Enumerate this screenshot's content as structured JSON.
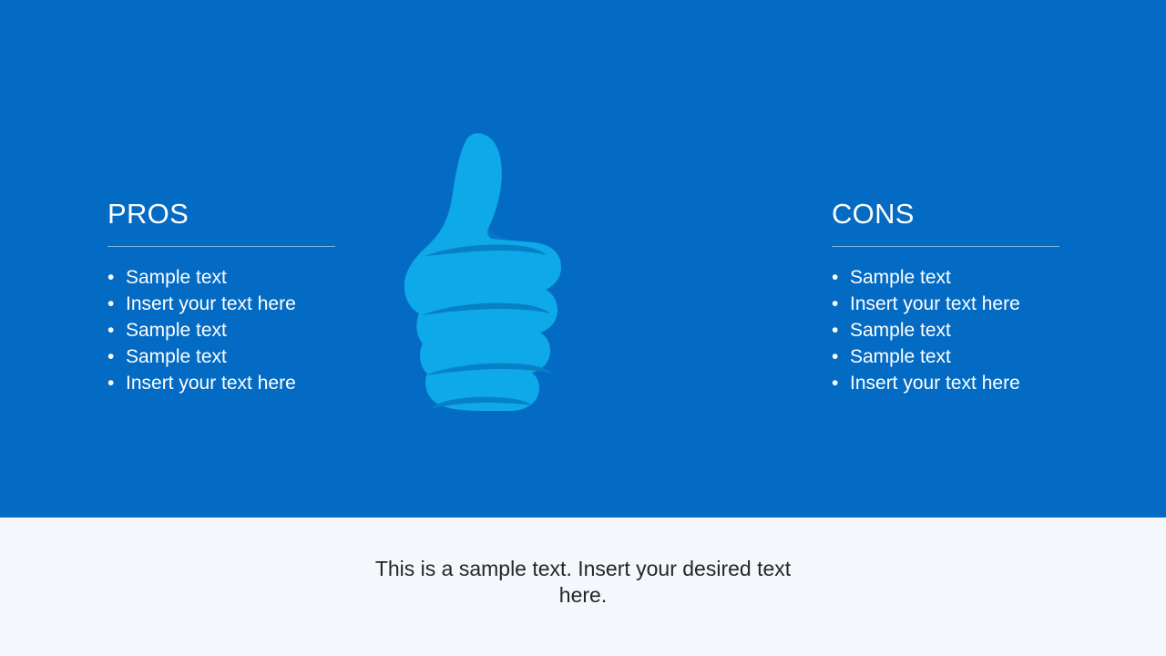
{
  "slide": {
    "background_color": "#036bc4",
    "caption_band_color": "#f4f7fc"
  },
  "pros": {
    "heading": "PROS",
    "items": [
      "Sample text",
      "Insert your text here",
      "Sample text",
      "Sample text",
      "Insert your text here"
    ]
  },
  "cons": {
    "heading": "CONS",
    "items": [
      "Sample text",
      "Insert your text here",
      "Sample text",
      "Sample text",
      "Insert your text here"
    ]
  },
  "bullet_glyph": "•",
  "artwork": {
    "thumbs_up_name": "thumbs-up-icon",
    "thumbs_up_color": "#0ea9e8",
    "thumbs_up_line_color": "#0780c6",
    "thumbs_down_name": "thumbs-down-icon",
    "thumbs_down_color": "#ffffff",
    "thumbs_down_line_color": "#1173b8"
  },
  "caption": {
    "text": "This is a sample text. Insert your desired text here.",
    "color": "#262626"
  }
}
